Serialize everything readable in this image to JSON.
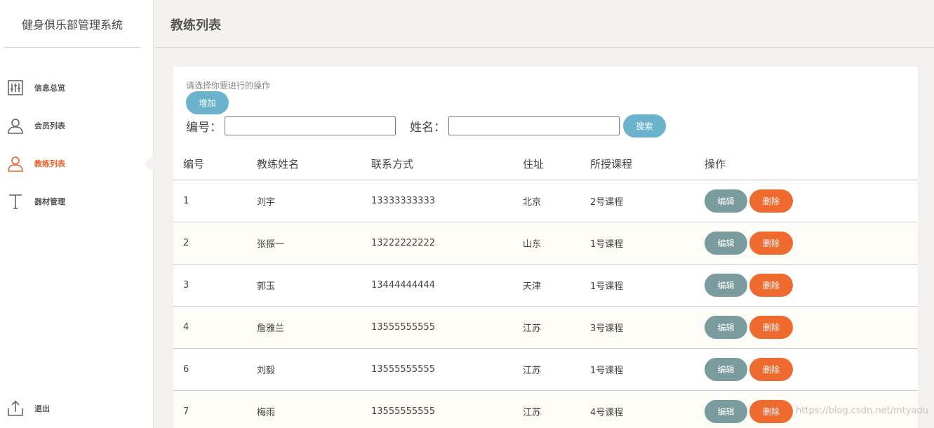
{
  "app": {
    "title": "健身俱乐部管理系统"
  },
  "sidebar": {
    "items": [
      {
        "label": "信息总览",
        "icon": "sliders-icon"
      },
      {
        "label": "会员列表",
        "icon": "user-icon"
      },
      {
        "label": "教练列表",
        "icon": "user-icon",
        "active": true
      },
      {
        "label": "器材管理",
        "icon": "text-t-icon"
      }
    ],
    "logout": {
      "label": "退出",
      "icon": "upload-icon"
    }
  },
  "header": {
    "title": "教练列表"
  },
  "panel": {
    "hint": "请选择你要进行的操作",
    "add_label": "增加",
    "search": {
      "id_label": "编号：",
      "id_value": "",
      "name_label": "姓名：",
      "name_value": "",
      "search_label": "搜索"
    }
  },
  "table": {
    "columns": [
      "编号",
      "教练姓名",
      "联系方式",
      "住址",
      "所授课程",
      "操作"
    ],
    "rows": [
      {
        "id": "1",
        "name": "刘宇",
        "phone": "13333333333",
        "address": "北京",
        "course": "2号课程"
      },
      {
        "id": "2",
        "name": "张振一",
        "phone": "13222222222",
        "address": "山东",
        "course": "1号课程"
      },
      {
        "id": "3",
        "name": "郭玉",
        "phone": "13444444444",
        "address": "天津",
        "course": "1号课程"
      },
      {
        "id": "4",
        "name": "詹雅兰",
        "phone": "13555555555",
        "address": "江苏",
        "course": "3号课程"
      },
      {
        "id": "6",
        "name": "刘毅",
        "phone": "13555555555",
        "address": "江苏",
        "course": "1号课程"
      },
      {
        "id": "7",
        "name": "梅雨",
        "phone": "13555555555",
        "address": "江苏",
        "course": "4号课程"
      }
    ],
    "edit_label": "编辑",
    "delete_label": "删除"
  },
  "watermark": "https://blog.csdn.net/mtyadu",
  "colors": {
    "accent": "#e5642b",
    "primary_button": "#6bb3cc",
    "edit_button": "#7a9c9e",
    "delete_button": "#ee6a2e"
  }
}
